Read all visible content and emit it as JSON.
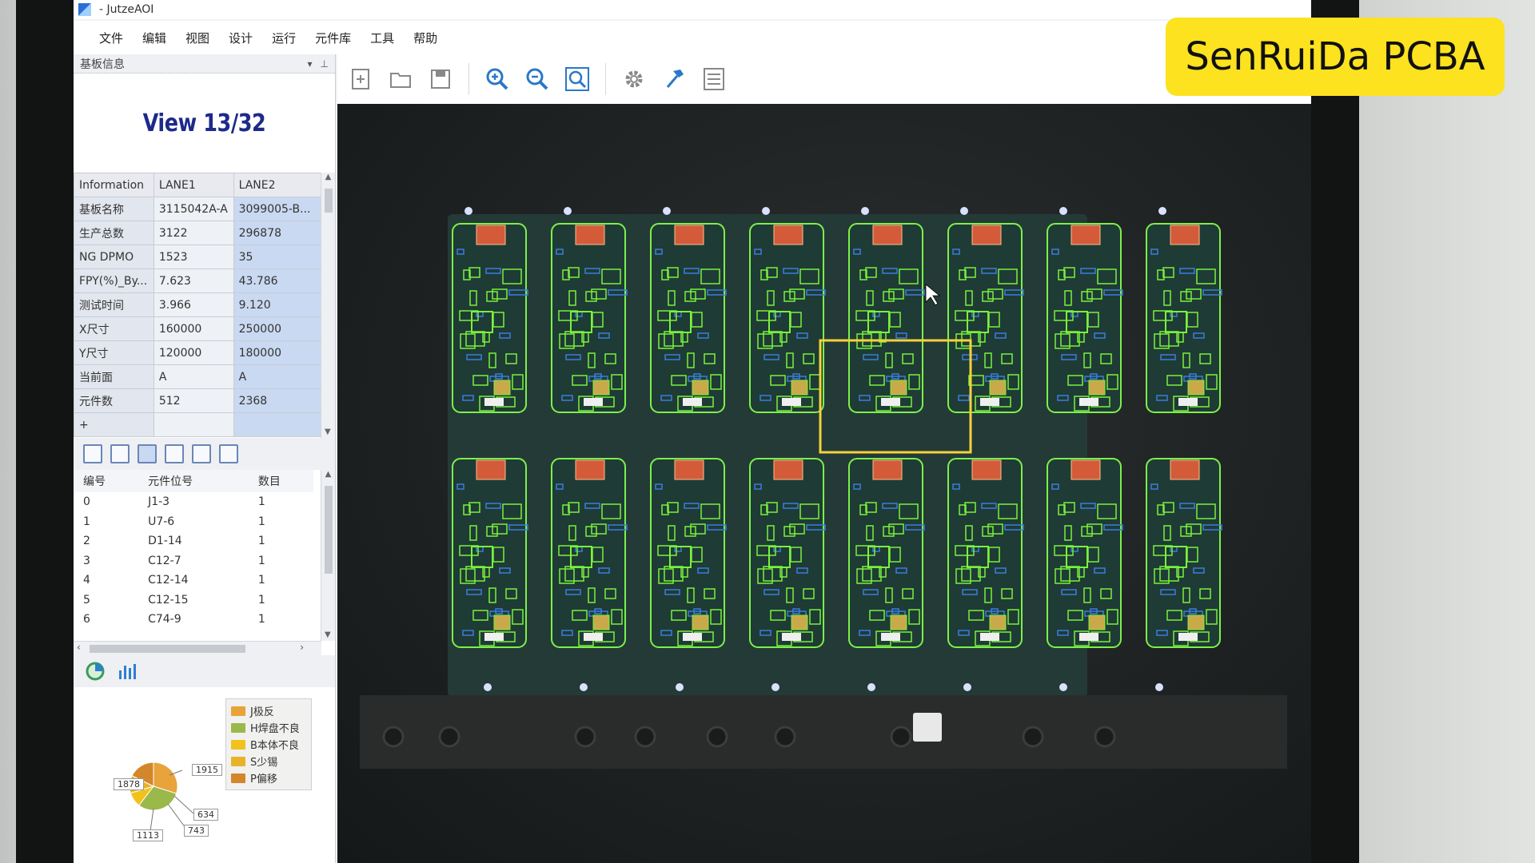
{
  "window": {
    "title": "- JutzeAOI"
  },
  "menu": [
    "文件",
    "编辑",
    "视图",
    "设计",
    "运行",
    "元件库",
    "工具",
    "帮助"
  ],
  "left_panel": {
    "header": "基板信息",
    "view_label": "View 13/32",
    "info_table": {
      "headers": [
        "Information",
        "LANE1",
        "LANE2"
      ],
      "rows": [
        [
          "基板名称",
          "3115042A-A",
          "3099005-B..."
        ],
        [
          "生产总数",
          "3122",
          "296878"
        ],
        [
          "NG DPMO",
          "1523",
          "35"
        ],
        [
          "FPY(%)_By...",
          "7.623",
          "43.786"
        ],
        [
          "测试时间",
          "3.966",
          "9.120"
        ],
        [
          "X尺寸",
          "160000",
          "250000"
        ],
        [
          "Y尺寸",
          "120000",
          "180000"
        ],
        [
          "当前面",
          "A",
          "A"
        ],
        [
          "元件数",
          "512",
          "2368"
        ]
      ],
      "add_row": "+"
    },
    "parts_table": {
      "headers": [
        "编号",
        "元件位号",
        "数目"
      ],
      "rows": [
        [
          "0",
          "J1-3",
          "1"
        ],
        [
          "1",
          "U7-6",
          "1"
        ],
        [
          "2",
          "D1-14",
          "1"
        ],
        [
          "3",
          "C12-7",
          "1"
        ],
        [
          "4",
          "C12-14",
          "1"
        ],
        [
          "5",
          "C12-15",
          "1"
        ],
        [
          "6",
          "C74-9",
          "1"
        ]
      ]
    },
    "defect_chart": {
      "legend": [
        "J极反",
        "H焊盘不良",
        "B本体不良",
        "S少锡",
        "P偏移"
      ],
      "callouts": [
        "1878",
        "1915",
        "634",
        "743",
        "1113"
      ],
      "colors": [
        "#e8a33a",
        "#9bb84a",
        "#f1c21c",
        "#e7b429",
        "#d4862a"
      ]
    }
  },
  "watermark": "SenRuiDa PCBA",
  "board": {
    "rows": 2,
    "cols": 8,
    "selected_index": 11
  },
  "chart_data": {
    "type": "pie",
    "values": [
      1878,
      1915,
      634,
      743,
      1113
    ],
    "labels": [],
    "title": ""
  }
}
